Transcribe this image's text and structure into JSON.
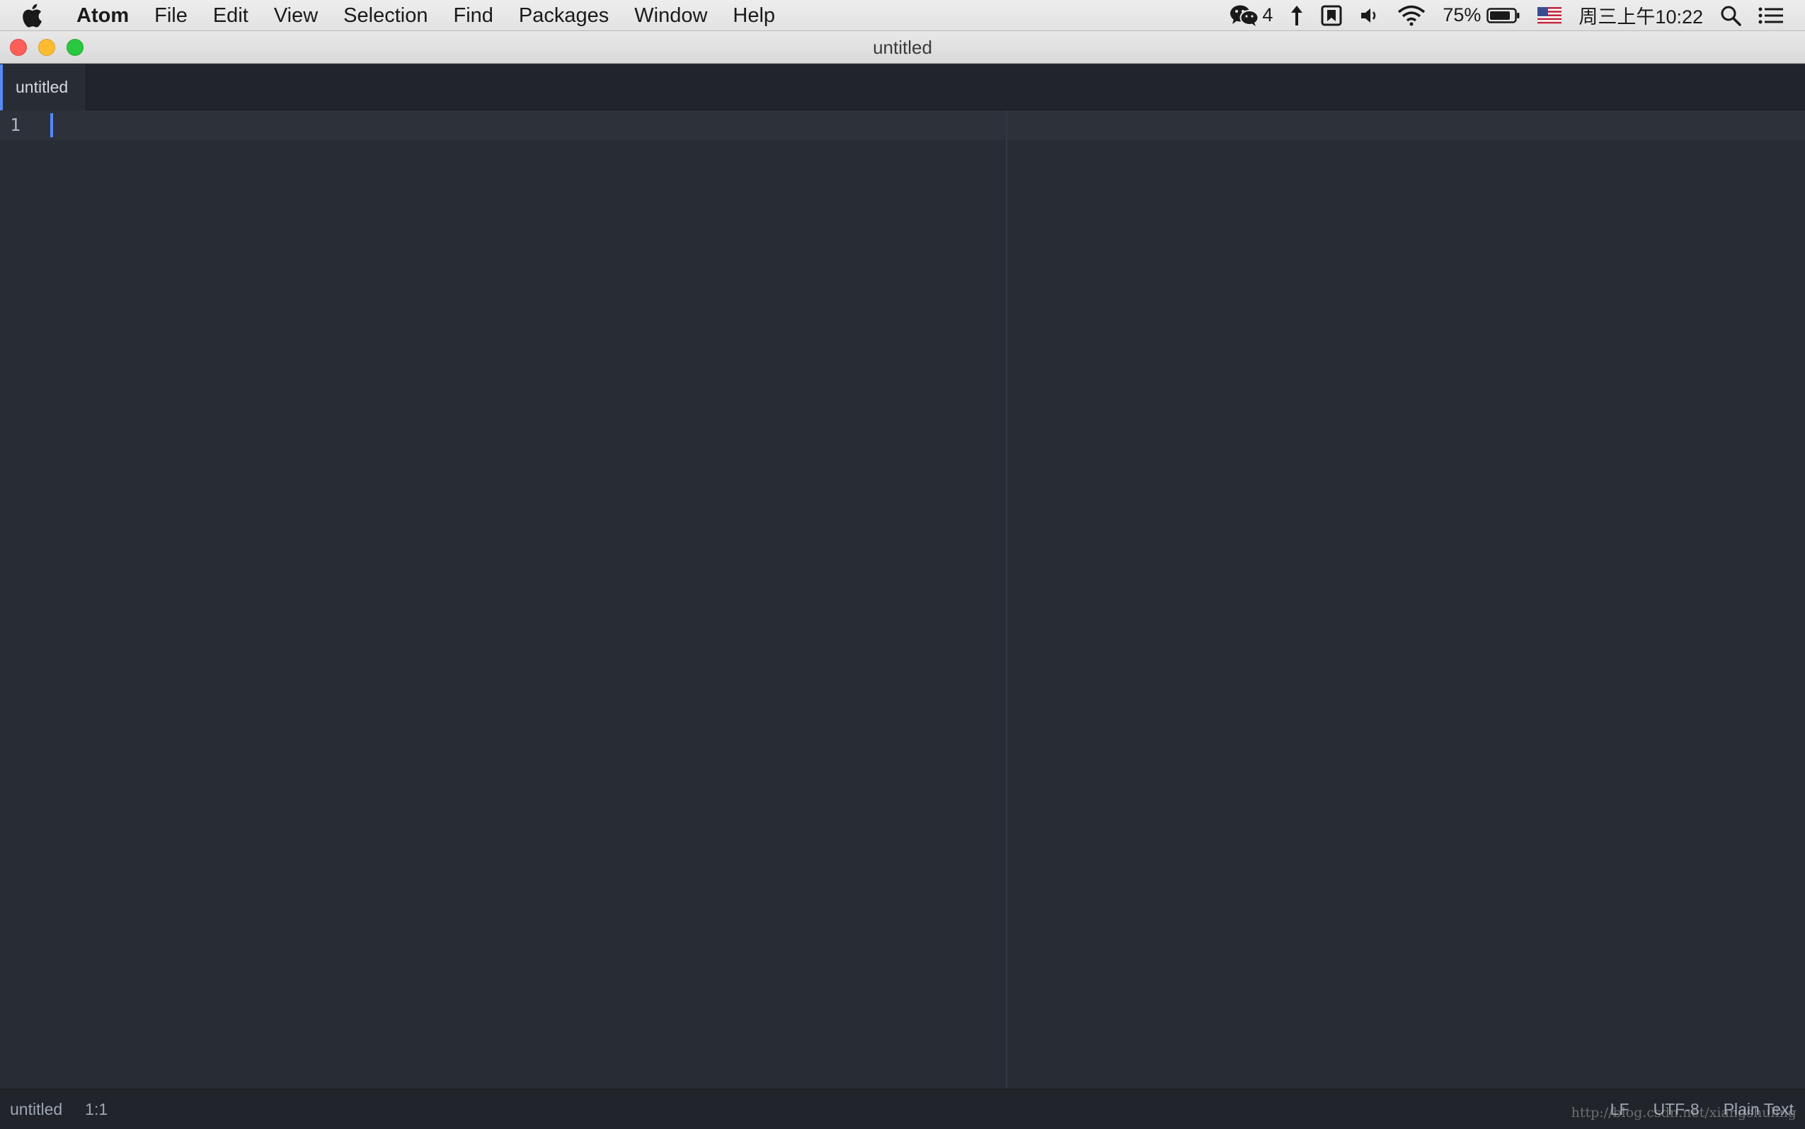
{
  "menubar": {
    "app_name": "Atom",
    "items": [
      "File",
      "Edit",
      "View",
      "Selection",
      "Find",
      "Packages",
      "Window",
      "Help"
    ],
    "status": {
      "wechat_count": "4",
      "battery_percent": "75%",
      "clock": "周三上午10:22"
    }
  },
  "window": {
    "title": "untitled"
  },
  "tabs": [
    {
      "label": "untitled",
      "active": true
    }
  ],
  "editor": {
    "line_numbers": [
      "1"
    ],
    "content": ""
  },
  "statusbar": {
    "file_name": "untitled",
    "cursor_position": "1:1",
    "line_ending": "LF",
    "encoding": "UTF-8",
    "grammar": "Plain Text"
  },
  "watermark": "http://blog.csdn.net/xiangshuling",
  "colors": {
    "accent": "#568af2",
    "editor_bg": "#282c34",
    "panel_bg": "#21252b"
  }
}
